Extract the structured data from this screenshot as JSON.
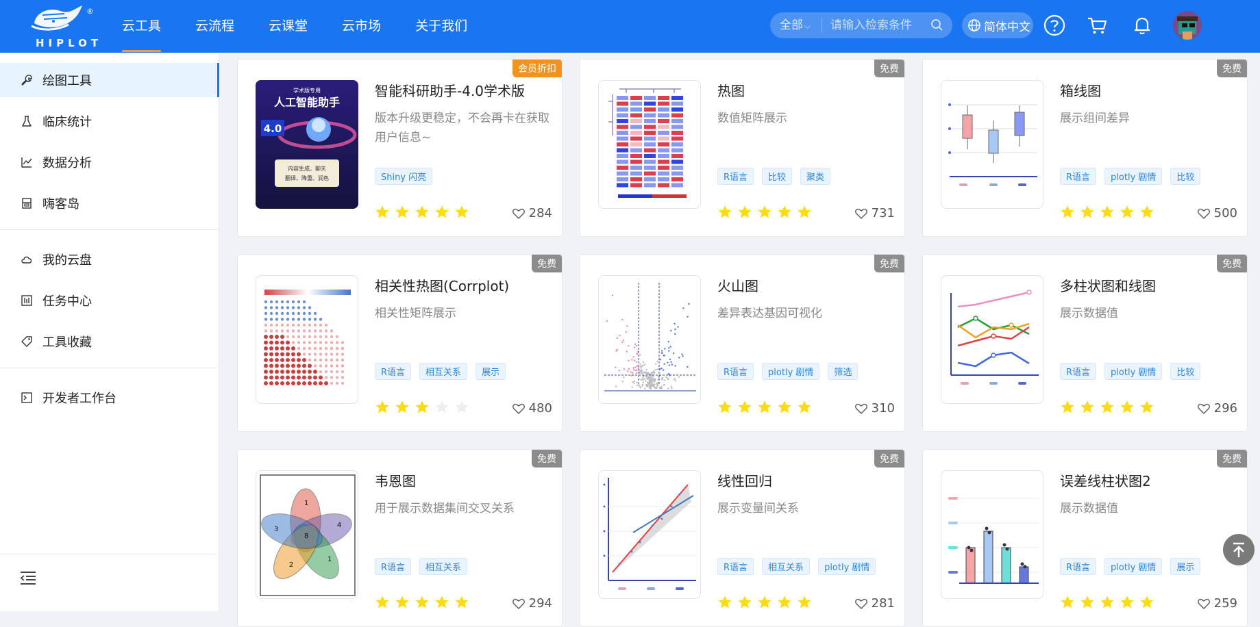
{
  "header": {
    "logo_text": "HIPLOT",
    "nav": [
      "云工具",
      "云流程",
      "云课堂",
      "云市场",
      "关于我们"
    ],
    "search": {
      "scope": "全部",
      "placeholder": "请输入检索条件"
    },
    "language": "简体中文"
  },
  "sidebar": {
    "items": [
      "绘图工具",
      "临床统计",
      "数据分析",
      "嗨客岛",
      "我的云盘",
      "任务中心",
      "工具收藏",
      "开发者工作台"
    ]
  },
  "cards": [
    {
      "title": "智能科研助手-4.0学术版",
      "desc": "版本升级更稳定，不会再卡在获取用户信息~",
      "tags": [
        "Shiny 闪亮"
      ],
      "rating": 5,
      "likes": "284",
      "badge": "会员折扣",
      "thumb_text": [
        "学术版专用",
        "人工智能助手",
        "4.0",
        "内容生成、聊天",
        "翻译、降重、润色"
      ]
    },
    {
      "title": "热图",
      "desc": "数值矩阵展示",
      "tags": [
        "R语言",
        "比较",
        "聚类"
      ],
      "rating": 5,
      "likes": "731",
      "badge": "免费"
    },
    {
      "title": "箱线图",
      "desc": "展示组间差异",
      "tags": [
        "R语言",
        "plotly 剧情",
        "比较"
      ],
      "rating": 5,
      "likes": "500",
      "badge": "免费"
    },
    {
      "title": "相关性热图(Corrplot)",
      "desc": "相关性矩阵展示",
      "tags": [
        "R语言",
        "相互关系",
        "展示"
      ],
      "rating": 3,
      "likes": "480",
      "badge": "免费"
    },
    {
      "title": "火山图",
      "desc": "差异表达基因可视化",
      "tags": [
        "R语言",
        "plotly 剧情",
        "筛选"
      ],
      "rating": 5,
      "likes": "310",
      "badge": "免费"
    },
    {
      "title": "多柱状图和线图",
      "desc": "展示数据值",
      "tags": [
        "R语言",
        "plotly 剧情",
        "比较"
      ],
      "rating": 5,
      "likes": "296",
      "badge": "免费"
    },
    {
      "title": "韦恩图",
      "desc": "用于展示数据集间交叉关系",
      "tags": [
        "R语言",
        "相互关系"
      ],
      "rating": 5,
      "likes": "294",
      "badge": "免费",
      "thumb_text": [
        "1",
        "4",
        "1",
        "2",
        "3",
        "8"
      ]
    },
    {
      "title": "线性回归",
      "desc": "展示变量间关系",
      "tags": [
        "R语言",
        "相互关系",
        "plotly 剧情"
      ],
      "rating": 5,
      "likes": "281",
      "badge": "免费"
    },
    {
      "title": "误差线柱状图2",
      "desc": "展示数据值",
      "tags": [
        "R语言",
        "plotly 剧情",
        "展示"
      ],
      "rating": 5,
      "likes": "259",
      "badge": "免费"
    }
  ],
  "colors": {
    "header_bg": "#1a75f0",
    "star": "#fadb14",
    "star_empty": "#eeeeee",
    "badge_member": "#f0941f",
    "badge_free": "#8c8c8c",
    "tag_text": "#2f86d9"
  }
}
